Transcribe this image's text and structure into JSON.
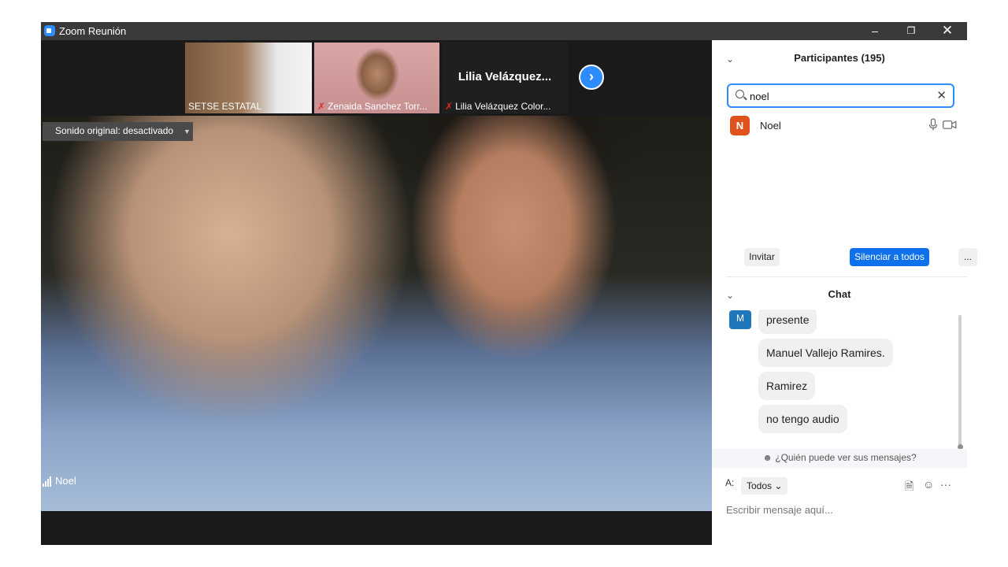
{
  "window": {
    "title": "Zoom Reunión"
  },
  "gallery": {
    "thumbnails": [
      {
        "name": "SETSE ESTATAL",
        "muted": false
      },
      {
        "name": "Zenaida Sanchez Torr...",
        "muted": true
      },
      {
        "name": "Lilia Velázquez Color...",
        "muted": true,
        "display_name": "Lilia  Velázquez..."
      }
    ]
  },
  "main_video": {
    "original_sound": "Sonido original: desactivado",
    "speaker": "Noel"
  },
  "participants": {
    "title": "Participantes (195)",
    "search_value": "noel",
    "list": [
      {
        "initial": "N",
        "name": "Noel",
        "avatar_color": "#e0521c"
      }
    ],
    "invite_label": "Invitar",
    "mute_all_label": "Silenciar a todos",
    "more_label": "..."
  },
  "chat": {
    "title": "Chat",
    "sender_initial": "M",
    "messages": [
      "presente",
      "Manuel Vallejo Ramires.",
      "Ramirez",
      "no tengo audio"
    ],
    "who_can_see": "¿Quién puede ver sus mensajes?",
    "to_label": "A:",
    "to_value": "Todos",
    "input_placeholder": "Escribir mensaje aquí...",
    "more_label": "···"
  },
  "colors": {
    "accent": "#2d8cff",
    "button_blue": "#0e71eb",
    "avatar_orange": "#e0521c",
    "muted_red": "#e02828"
  }
}
